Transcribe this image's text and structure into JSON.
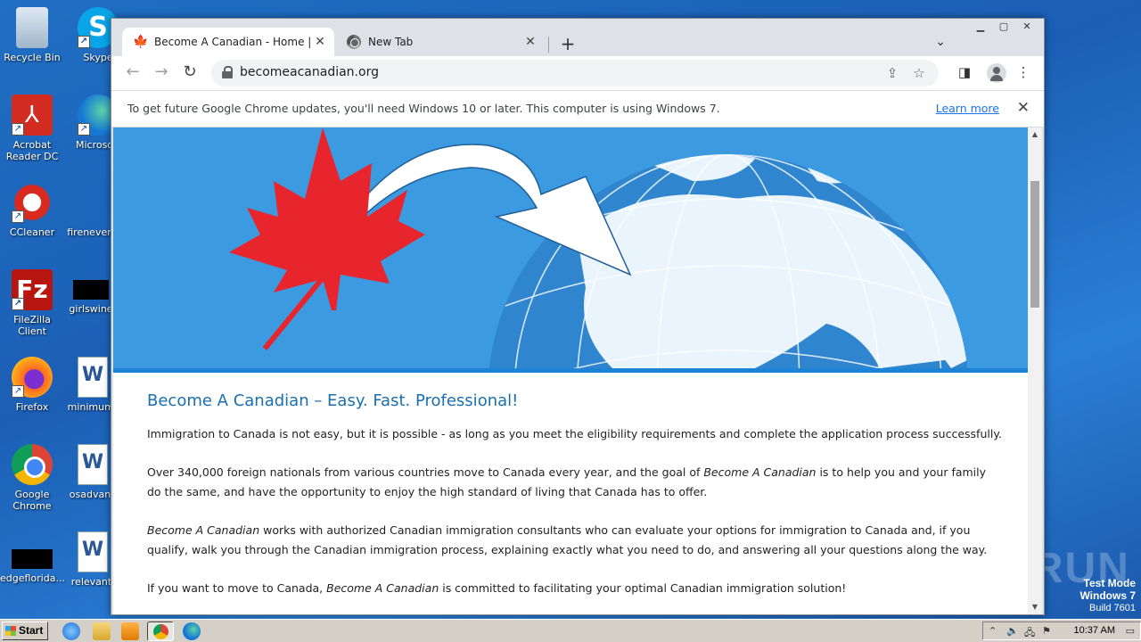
{
  "desktop": {
    "icons": [
      {
        "label": "Recycle Bin"
      },
      {
        "label": "Skype"
      },
      {
        "label": "Acrobat Reader DC"
      },
      {
        "label": "Microsoft"
      },
      {
        "label": "CCleaner"
      },
      {
        "label": "firenever"
      },
      {
        "label": "FileZilla Client"
      },
      {
        "label": "girlswine"
      },
      {
        "label": "Firefox"
      },
      {
        "label": "minimumr"
      },
      {
        "label": "Google Chrome"
      },
      {
        "label": "osadvanc"
      },
      {
        "label": "edgeflorida..."
      },
      {
        "label": "relevanti"
      }
    ]
  },
  "browser": {
    "tabs": [
      {
        "title": "Become A Canadian - Home | Start y",
        "close": "✕"
      },
      {
        "title": "New Tab",
        "close": "✕"
      }
    ],
    "new_tab": "+",
    "url": "becomeacanadian.org",
    "infobar": {
      "message": "To get future Google Chrome updates, you'll need Windows 10 or later. This computer is using Windows 7.",
      "link": "Learn more",
      "close": "✕"
    }
  },
  "page": {
    "heading": "Become A Canadian – Easy. Fast. Professional!",
    "p1": "Immigration to Canada is not easy, but it is possible - as long as you meet the eligibility requirements and complete the application process successfully.",
    "p2_a": "Over 340,000 foreign nationals from various countries move to Canada every year, and the goal of ",
    "p2_em": "Become A Canadian",
    "p2_b": " is to help you and your family do the same, and have the opportunity to enjoy the high standard of living that Canada has to offer.",
    "p3_em": "Become A Canadian",
    "p3_b": " works with authorized Canadian immigration consultants who can evaluate your options for immigration to Canada and, if you qualify, walk you through the Canadian immigration process, explaining exactly what you need to do, and answering all your questions along the way.",
    "p4_a": "If you want to move to Canada, ",
    "p4_em": "Become A Canadian",
    "p4_b": " is committed to facilitating your optimal Canadian immigration solution!"
  },
  "taskbar": {
    "start": "Start",
    "time": "10:37 AM"
  },
  "watermark": {
    "line1": "Test Mode",
    "line2": "Windows 7",
    "line3": "Build 7601",
    "brand": "ANY RUN"
  },
  "colors": {
    "link": "#1a73e8",
    "heading": "#1a6fb0",
    "hero_bg": "#3c9be0",
    "maple": "#e8252d"
  }
}
